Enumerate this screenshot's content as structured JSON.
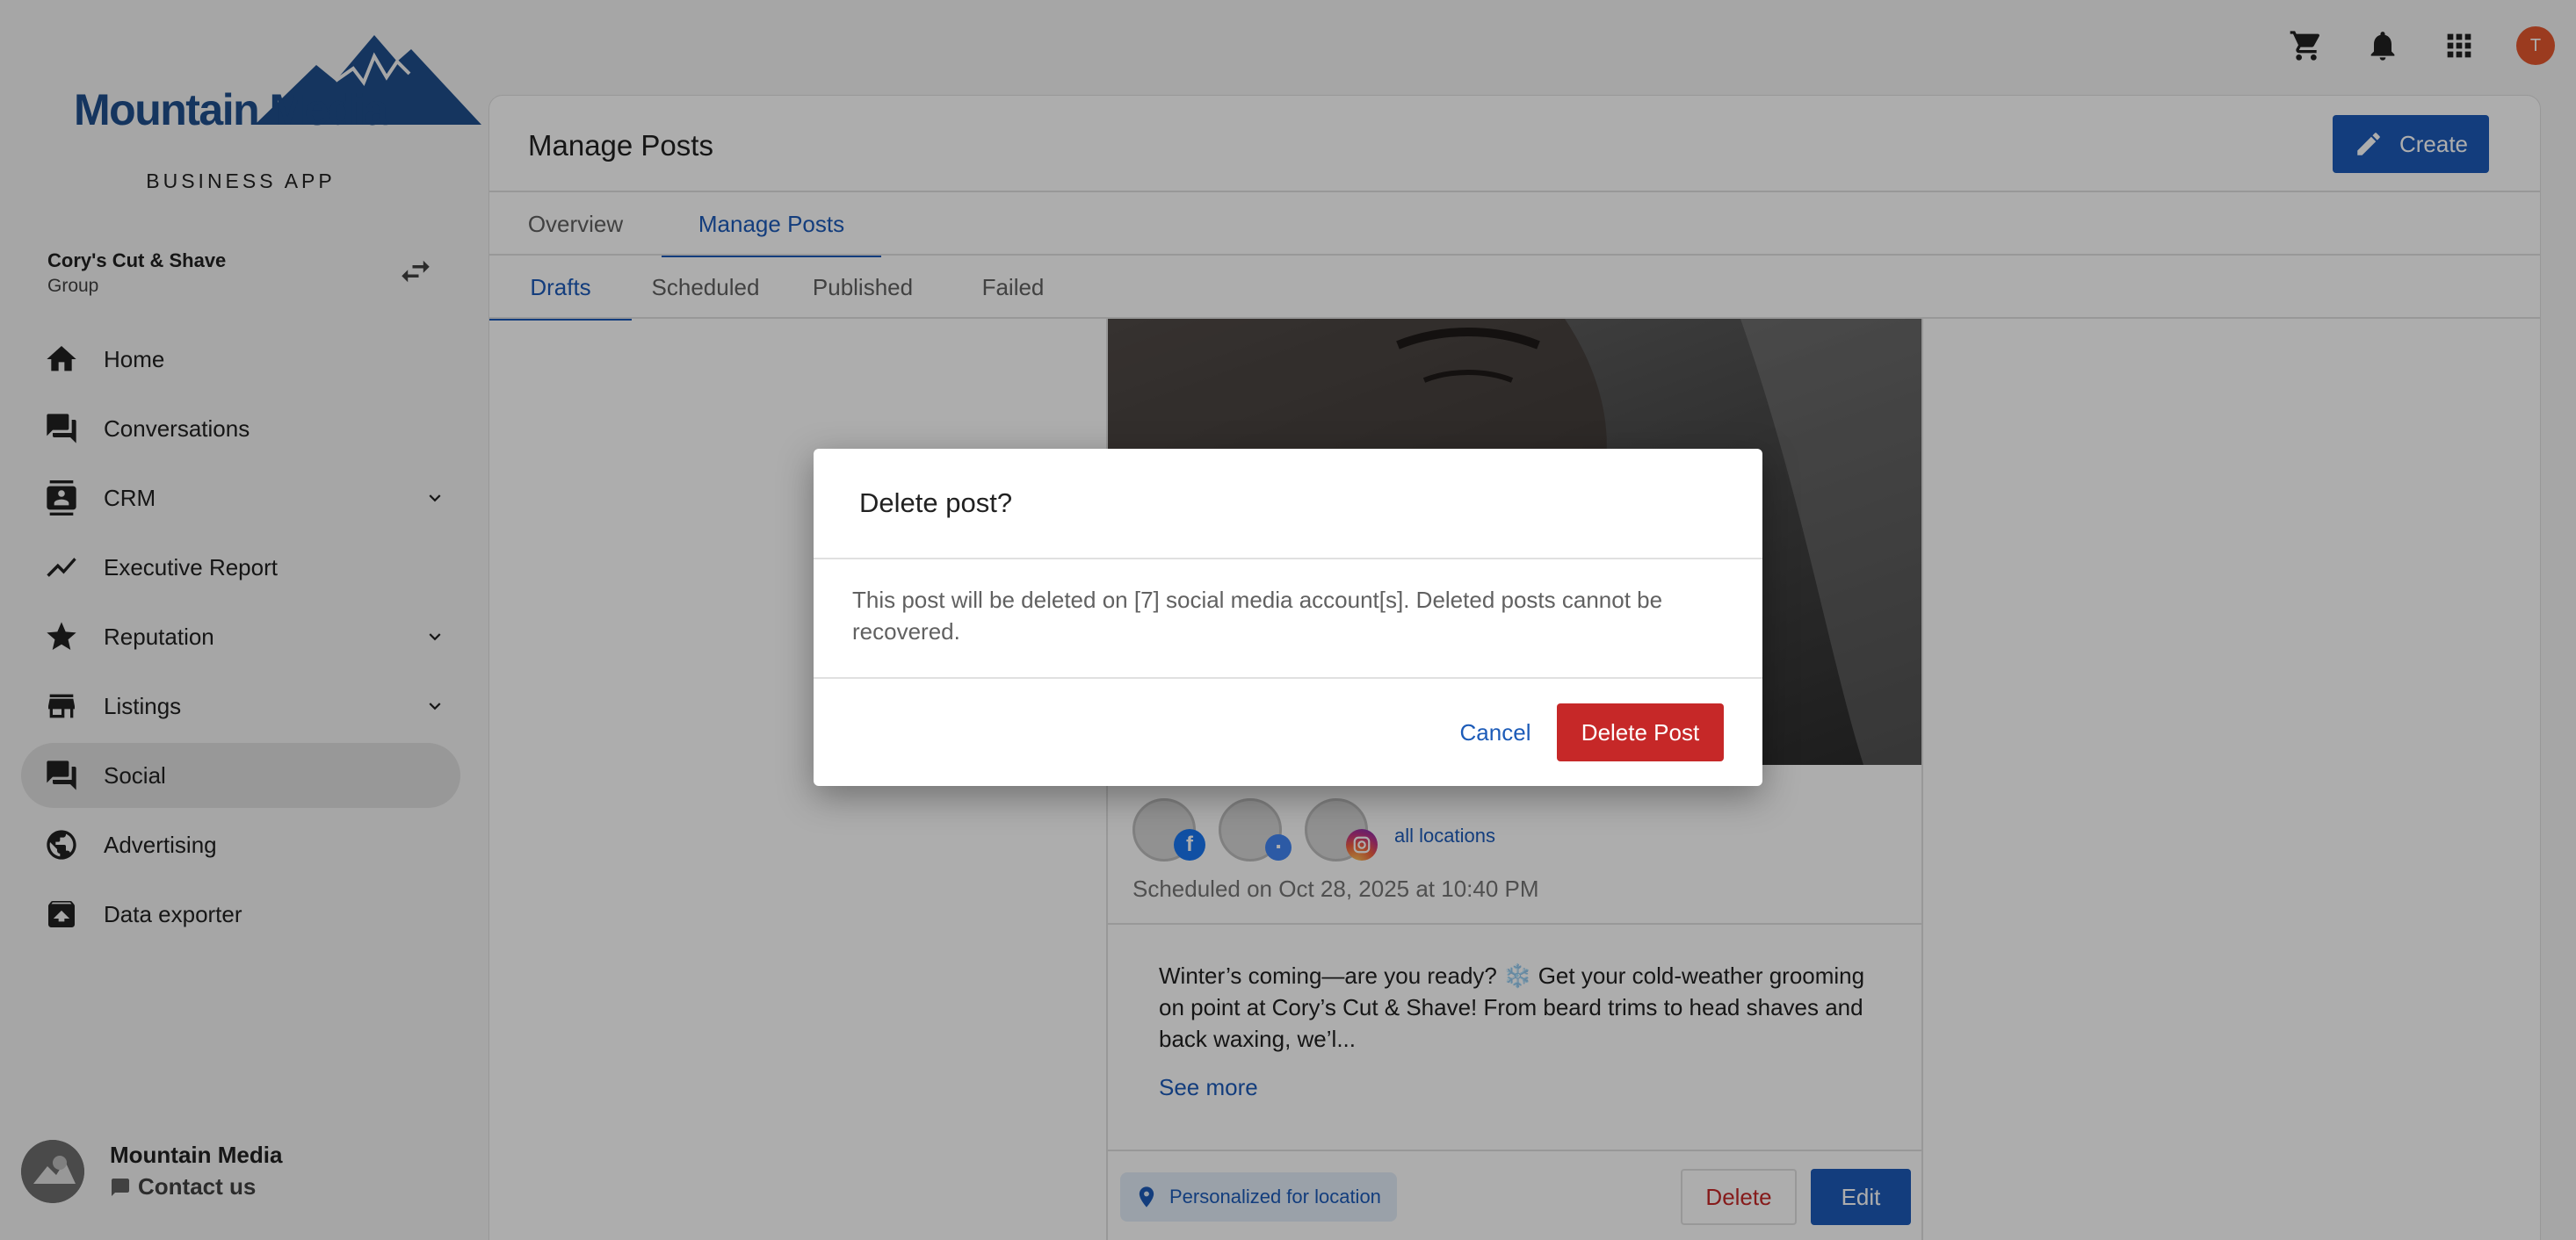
{
  "brand": {
    "logo_text": "Mountain Media",
    "subtitle": "BUSINESS APP"
  },
  "account": {
    "name": "Cory's Cut & Shave",
    "type": "Group"
  },
  "sidebar": {
    "items": [
      {
        "label": "Home",
        "icon": "home-icon"
      },
      {
        "label": "Conversations",
        "icon": "chat-icon"
      },
      {
        "label": "CRM",
        "icon": "contacts-icon",
        "expandable": true
      },
      {
        "label": "Executive Report",
        "icon": "trend-icon"
      },
      {
        "label": "Reputation",
        "icon": "star-icon",
        "expandable": true
      },
      {
        "label": "Listings",
        "icon": "store-icon",
        "expandable": true
      },
      {
        "label": "Social",
        "icon": "chat-icon",
        "active": true
      },
      {
        "label": "Advertising",
        "icon": "globe-icon"
      },
      {
        "label": "Data exporter",
        "icon": "export-icon"
      }
    ],
    "footer": {
      "name": "Mountain Media",
      "contact": "Contact us"
    }
  },
  "topbar": {
    "icons": [
      "cart-icon",
      "bell-icon",
      "apps-icon"
    ],
    "user_initial": "T"
  },
  "main": {
    "title": "Manage Posts",
    "create_label": "Create",
    "tabs": [
      "Overview",
      "Manage Posts"
    ],
    "active_tab": "Manage Posts",
    "subtabs": [
      "Drafts",
      "Scheduled",
      "Published",
      "Failed"
    ],
    "active_subtab": "Drafts"
  },
  "post": {
    "all_locations": "all locations",
    "scheduled": "Scheduled on Oct 28, 2025 at 10:40 PM",
    "text": "Winter’s coming—are you ready? ❄️ Get your cold-weather grooming on point at Cory’s Cut & Shave! From beard trims to head shaves and back waxing, we’l...",
    "see_more": "See more",
    "personalized": "Personalized for location",
    "delete_label": "Delete",
    "edit_label": "Edit"
  },
  "dialog": {
    "title": "Delete post?",
    "body": "This post will be deleted on [7] social media account[s]. Deleted posts cannot be recovered.",
    "cancel_label": "Cancel",
    "confirm_label": "Delete Post"
  },
  "colors": {
    "primary": "#1c5bb8",
    "danger": "#c62828",
    "avatar": "#e5582f"
  }
}
